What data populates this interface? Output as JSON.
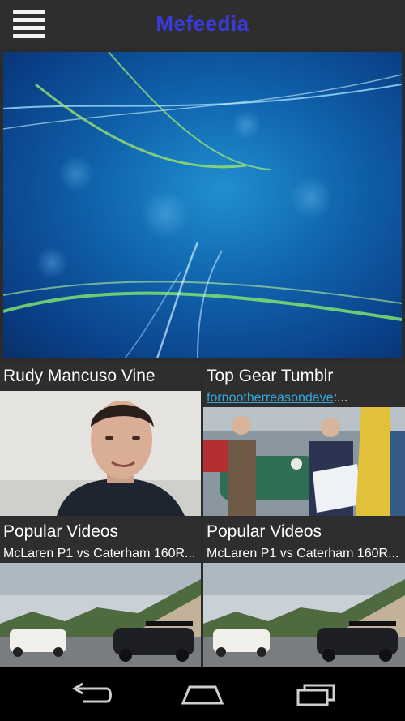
{
  "app": {
    "title": "Mefeedia"
  },
  "tiles": [
    {
      "title": "Rudy Mancuso Vine",
      "subtitle": ""
    },
    {
      "title": "Top Gear Tumblr",
      "subtitle_link": "fornootherreasondave",
      "subtitle_rest": ":..."
    },
    {
      "title": "Popular Videos",
      "subtitle": "McLaren P1 vs Caterham 160R..."
    },
    {
      "title": "Popular Videos",
      "subtitle": "McLaren P1 vs Caterham 160R..."
    }
  ],
  "icons": {
    "menu": "hamburger-menu-icon",
    "back": "back-icon",
    "home": "home-icon",
    "recents": "recent-apps-icon"
  },
  "colors": {
    "title": "#3a3ad8",
    "link": "#33aadf",
    "bar": "#2e2e2e"
  }
}
